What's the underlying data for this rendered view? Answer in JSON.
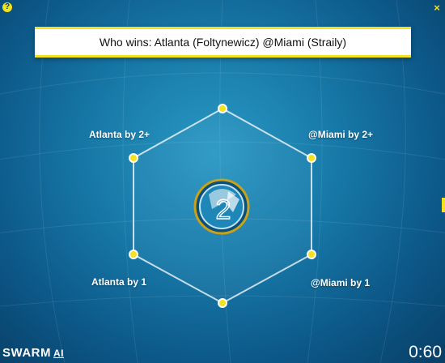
{
  "header": {
    "help_icon": "question-icon",
    "help_glyph": "?",
    "close_icon": "close-icon",
    "close_glyph": "×"
  },
  "question": "Who wins: Atlanta (Foltynewicz) @Miami (Straily)",
  "answers": {
    "top_left": "Atlanta by 2+",
    "top_right": "@Miami by 2+",
    "bottom_left": "Atlanta by 1",
    "bottom_right": "@Miami by 1"
  },
  "puck": {
    "label": "2"
  },
  "branding": {
    "name": "SWARM",
    "suffix": "AI"
  },
  "timer": "0:60",
  "colors": {
    "accent": "#f3e21e",
    "background": "#1779a8",
    "text": "#ffffff"
  }
}
